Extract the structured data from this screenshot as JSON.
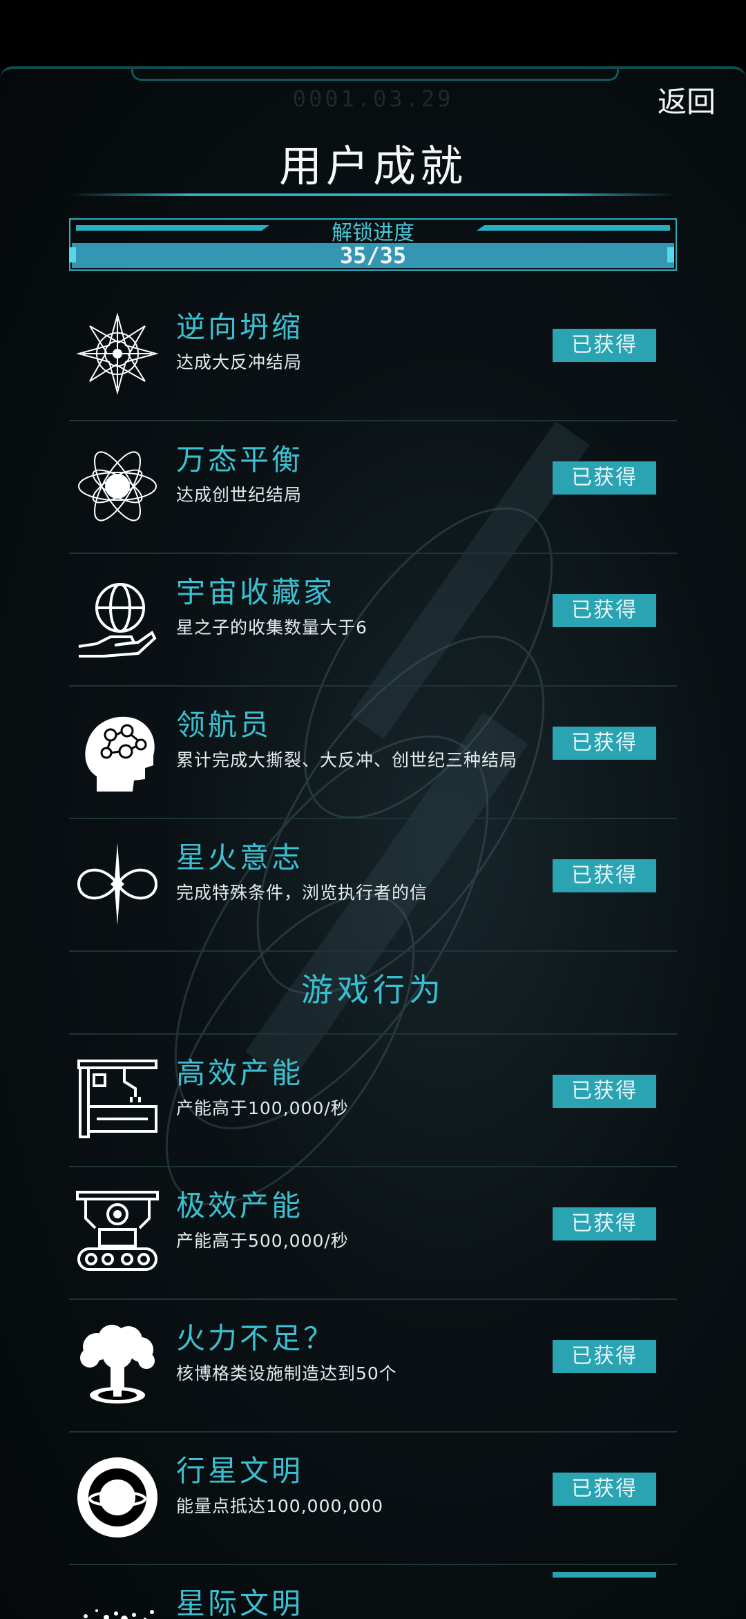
{
  "header": {
    "date": "0001.03.29",
    "back_label": "返回",
    "title": "用户成就"
  },
  "progress": {
    "label": "解锁进度",
    "value_text": "35/35",
    "unlocked": 35,
    "total": 35
  },
  "colors": {
    "accent": "#2aa3b3",
    "title_cyan": "#3cc0d2",
    "background": "#05090b"
  },
  "achievements": [
    {
      "name": "逆向坍缩",
      "desc": "达成大反冲结局",
      "status": "已获得",
      "icon": "mandala-star-icon"
    },
    {
      "name": "万态平衡",
      "desc": "达成创世纪结局",
      "status": "已获得",
      "icon": "orbit-atom-icon"
    },
    {
      "name": "宇宙收藏家",
      "desc": "星之子的收集数量大于6",
      "status": "已获得",
      "icon": "hand-globe-icon"
    },
    {
      "name": "领航员",
      "desc": "累计完成大撕裂、大反冲、创世纪三种结局",
      "status": "已获得",
      "icon": "brain-head-icon"
    },
    {
      "name": "星火意志",
      "desc": "完成特殊条件，浏览执行者的信",
      "status": "已获得",
      "icon": "infinity-star-icon"
    }
  ],
  "section_title": "游戏行为",
  "behaviors": [
    {
      "name": "高效产能",
      "desc": "产能高于100,000/秒",
      "status": "已获得",
      "icon": "robot-arm-icon"
    },
    {
      "name": "极效产能",
      "desc": "产能高于500,000/秒",
      "status": "已获得",
      "icon": "conveyor-gear-icon"
    },
    {
      "name": "火力不足？",
      "desc": "核博格类设施制造达到50个",
      "status": "已获得",
      "icon": "mushroom-cloud-icon"
    },
    {
      "name": "行星文明",
      "desc": "能量点抵达100,000,000",
      "status": "已获得",
      "icon": "ringed-planet-icon"
    }
  ],
  "last_item": {
    "name": "星际文明",
    "icon": "star-cluster-icon"
  }
}
